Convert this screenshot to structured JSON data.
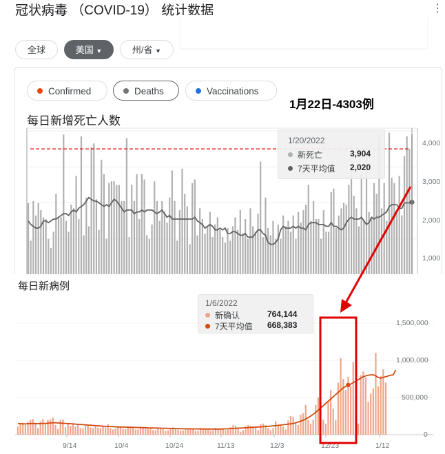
{
  "header": {
    "title": "冠状病毒 （COVID-19） 统计数据",
    "more": "⋮"
  },
  "region_chips": [
    {
      "label": "全球",
      "selected": false
    },
    {
      "label": "美国",
      "selected": true,
      "dropdown": true
    },
    {
      "label": "州/省",
      "selected": false,
      "dropdown": true
    }
  ],
  "metric_tabs": [
    {
      "label": "Confirmed",
      "color": "#e8470e",
      "selected": false
    },
    {
      "label": "Deaths",
      "color": "#757575",
      "selected": true
    },
    {
      "label": "Vaccinations",
      "color": "#1a73e8",
      "selected": false
    }
  ],
  "annotation": {
    "text": "1月22日-4303例",
    "color": "#e00000"
  },
  "deaths_chart": {
    "title": "每日新增死亡人数",
    "tooltip": {
      "date": "1/20/2022",
      "new_label": "新死亡",
      "new_value": "3,904",
      "avg_label": "7天平均值",
      "avg_value": "2,020"
    },
    "y_tick_labels": [
      "4,000",
      "3,000",
      "2,000",
      "1,000"
    ]
  },
  "cases_chart": {
    "title": "每日新病例",
    "tooltip": {
      "date": "1/6/2022",
      "new_label": "新确认",
      "new_value": "764,144",
      "avg_label": "7天平均值",
      "avg_value": "668,383"
    },
    "y_tick_labels": [
      "1,500,000",
      "1,000,000",
      "500,000",
      "0"
    ],
    "x_tick_labels": [
      "9/14",
      "10/4",
      "10/24",
      "11/13",
      "12/3",
      "12/23",
      "1/12"
    ]
  },
  "chart_data": [
    {
      "type": "bar",
      "title": "每日新增死亡人数",
      "xlabel": "",
      "ylabel": "",
      "ylim": [
        0,
        4200
      ],
      "bar_color": "#b0b0b0",
      "avg_color": "#616161",
      "reference_line": {
        "value": 3500,
        "color": "#e00000",
        "style": "dashed"
      },
      "series": [
        {
          "name": "新死亡",
          "values": [
            2000,
            950,
            2050,
            1650,
            2000,
            1800,
            1600,
            1550,
            1000,
            750,
            1200,
            2250,
            1600,
            1600,
            3900,
            1500,
            1200,
            1950,
            1850,
            2750,
            1550,
            3850,
            1100,
            2150,
            1350,
            3550,
            3650,
            2100,
            1250,
            3200,
            2800,
            1000,
            2550,
            2600,
            2600,
            2500,
            2500,
            2050,
            2050,
            3800,
            1050,
            2500,
            2050,
            2800,
            1550,
            2800,
            2650,
            1100,
            1000,
            1400,
            2600,
            2050,
            1500,
            2050,
            1750,
            1450,
            2150,
            2900,
            2050,
            950,
            1800,
            2950,
            2250,
            1900,
            850,
            2550,
            2650,
            1100,
            1850,
            1550,
            1150,
            1350,
            1750,
            1050,
            1400,
            1600,
            1250,
            1050,
            900,
            1300,
            950,
            1350,
            1600,
            1250,
            1800,
            1150,
            1550,
            1000,
            1850,
            1350,
            1200,
            1700,
            3150,
            1050,
            2150,
            1300,
            1100,
            1500,
            1000,
            1400,
            1000,
            1650,
            1350,
            1500,
            1200,
            1650,
            1000,
            1750,
            1450,
            1800,
            1950,
            2500,
            1500,
            2050,
            1550,
            1550,
            1000,
            1800,
            1200,
            1200,
            2300,
            2400,
            1300,
            1650,
            1850,
            2000,
            1950,
            2500,
            3000,
            2200,
            1850,
            1350,
            2800,
            1500,
            3300,
            1750,
            1600,
            2550,
            2250,
            3900,
            1850,
            2550,
            1500,
            3950,
            2700,
            2550,
            1700,
            2750,
            1650,
            3300,
            3850,
            3500,
            3904
          ]
        },
        {
          "name": "7天平均值",
          "values": [
            1500,
            1400,
            1350,
            1300,
            1300,
            1350,
            1500,
            1500,
            1450,
            1500,
            1550,
            1550,
            1600,
            1650,
            1700,
            1700,
            1650,
            1750,
            1800,
            1750,
            1850,
            1900,
            1950,
            2050,
            2150,
            2100,
            2050,
            2050,
            2000,
            1950,
            1900,
            1950,
            1900,
            2000,
            2100,
            2050,
            1950,
            1850,
            1750,
            1800,
            1800,
            1800,
            1700,
            1750,
            1750,
            1800,
            1750,
            1800,
            1800,
            1800,
            1750,
            1700,
            1750,
            1800,
            1700,
            1600,
            1650,
            1550,
            1550,
            1550,
            1550,
            1550,
            1550,
            1550,
            1550,
            1550,
            1600,
            1500,
            1450,
            1400,
            1300,
            1350,
            1400,
            1350,
            1250,
            1250,
            1300,
            1250,
            1300,
            1150,
            1150,
            1200,
            1200,
            1150,
            1100,
            1100,
            1150,
            1050,
            1050,
            1050,
            1150,
            1250,
            1250,
            1150,
            1100,
            900,
            850,
            850,
            900,
            1000,
            1250,
            1350,
            1300,
            1300,
            1300,
            1350,
            1300,
            1350,
            1300,
            1300,
            1250,
            1400,
            1450,
            1450,
            1450,
            1400,
            1400,
            1400,
            1350,
            1350,
            1450,
            1350,
            1350,
            1300,
            1250,
            1300,
            1450,
            1550,
            1600,
            1550,
            1550,
            1550,
            1600,
            1500,
            1400,
            1450,
            1600,
            1550,
            1600,
            1600,
            1650,
            1700,
            1750,
            1900,
            1950,
            1950,
            1950,
            1850,
            1850,
            2000,
            2000,
            2000,
            2020
          ]
        }
      ]
    },
    {
      "type": "bar",
      "title": "每日新病例",
      "xlabel": "",
      "ylabel": "",
      "ylim": [
        0,
        1600000
      ],
      "yticks": [
        0,
        500000,
        1000000,
        1500000
      ],
      "x_ticks": [
        "9/14",
        "10/4",
        "10/24",
        "11/13",
        "12/3",
        "12/23",
        "1/12"
      ],
      "bar_color": "#f0a48a",
      "avg_color": "#d14a10",
      "highlight_box": {
        "from_index": 124,
        "to_index": 134,
        "color": "#e00000"
      },
      "series": [
        {
          "name": "新确认",
          "values": [
            110000,
            140000,
            160000,
            130000,
            170000,
            200000,
            210000,
            150000,
            90000,
            180000,
            210000,
            150000,
            195000,
            205000,
            230000,
            130000,
            75000,
            200000,
            205000,
            100000,
            150000,
            120000,
            150000,
            110000,
            140000,
            90000,
            85000,
            120000,
            130000,
            100000,
            90000,
            110000,
            95000,
            90000,
            110000,
            100000,
            140000,
            90000,
            70000,
            85000,
            110000,
            95000,
            80000,
            75000,
            110000,
            90000,
            90000,
            70000,
            70000,
            90000,
            100000,
            85000,
            80000,
            90000,
            60000,
            60000,
            90000,
            85000,
            75000,
            50000,
            60000,
            90000,
            100000,
            85000,
            70000,
            55000,
            60000,
            80000,
            85000,
            80000,
            80000,
            50000,
            55000,
            90000,
            80000,
            70000,
            65000,
            55000,
            60000,
            90000,
            80000,
            75000,
            70000,
            60000,
            70000,
            100000,
            130000,
            120000,
            80000,
            40000,
            60000,
            110000,
            130000,
            120000,
            100000,
            90000,
            60000,
            140000,
            150000,
            130000,
            90000,
            60000,
            90000,
            180000,
            120000,
            130000,
            110000,
            70000,
            190000,
            250000,
            240000,
            160000,
            130000,
            270000,
            290000,
            400000,
            200000,
            150000,
            200000,
            400000,
            500000,
            450000,
            200000,
            150000,
            450000,
            600000,
            350000,
            200000,
            700000,
            1030000,
            750000,
            600000,
            780000,
            650000,
            980000,
            450000,
            150000,
            800000,
            850000,
            770000,
            440000,
            550000,
            620000,
            1100000,
            650000,
            790000,
            880000,
            700000
          ]
        },
        {
          "name": "7天平均值",
          "values": [
            150000,
            148000,
            146000,
            145000,
            148000,
            150000,
            152000,
            150000,
            148000,
            150000,
            152000,
            153000,
            155000,
            158000,
            160000,
            160000,
            158000,
            156000,
            155000,
            152000,
            150000,
            148000,
            145000,
            143000,
            140000,
            138000,
            135000,
            132000,
            130000,
            128000,
            125000,
            122000,
            120000,
            118000,
            115000,
            113000,
            112000,
            110000,
            108000,
            106000,
            105000,
            104000,
            103000,
            102000,
            101000,
            100000,
            99000,
            98000,
            97000,
            96000,
            95000,
            94000,
            93000,
            92000,
            91000,
            90000,
            89000,
            88000,
            87000,
            86000,
            85000,
            84000,
            83000,
            82000,
            82000,
            81000,
            80000,
            80000,
            79000,
            79000,
            78000,
            78000,
            78000,
            77000,
            77000,
            77000,
            76000,
            76000,
            76000,
            76000,
            76000,
            77000,
            78000,
            79000,
            80000,
            82000,
            84000,
            86000,
            88000,
            90000,
            92000,
            94000,
            96000,
            98000,
            100000,
            102000,
            104000,
            106000,
            108000,
            110000,
            113000,
            116000,
            119000,
            122000,
            126000,
            130000,
            134000,
            138000,
            142000,
            146000,
            150000,
            160000,
            170000,
            182000,
            195000,
            210000,
            230000,
            250000,
            275000,
            300000,
            330000,
            360000,
            390000,
            420000,
            450000,
            480000,
            510000,
            540000,
            570000,
            600000,
            630000,
            650000,
            668383,
            680000,
            700000,
            720000,
            740000,
            760000,
            780000,
            790000,
            800000,
            805000,
            806000,
            790000,
            770000,
            760000,
            770000,
            780000,
            790000,
            800000,
            805000,
            870000
          ]
        }
      ]
    }
  ]
}
